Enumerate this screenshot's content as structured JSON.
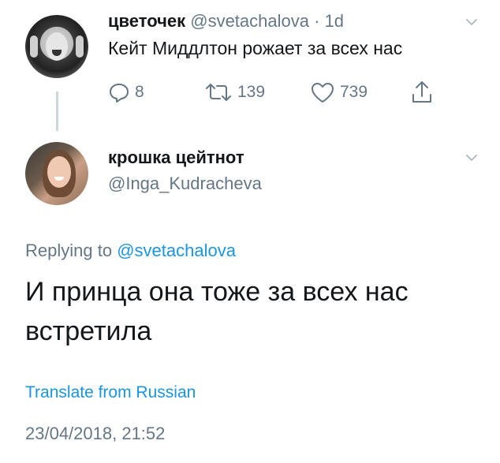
{
  "parent_tweet": {
    "display_name": "цветочек",
    "handle": "@svetachalova",
    "separator": "·",
    "time": "1d",
    "text": "Кейт Миддлтон рожает за всех нас",
    "actions": {
      "reply_count": "8",
      "retweet_count": "139",
      "like_count": "739"
    }
  },
  "reply_tweet": {
    "display_name": "крошка цейтнот",
    "handle": "@Inga_Kudracheva",
    "replying_prefix": "Replying to",
    "replying_mention": "@svetachalova",
    "text": "И принца она тоже за всех нас встретила",
    "translate_label": "Translate from Russian",
    "timestamp": "23/04/2018, 21:52"
  },
  "colors": {
    "text": "#14171a",
    "secondary": "#657786",
    "link": "#1b95e0",
    "thread_line": "#ccd6dd"
  },
  "icons": {
    "reply": "reply-icon",
    "retweet": "retweet-icon",
    "like": "heart-icon",
    "share": "share-icon",
    "menu": "chevron-down-icon"
  }
}
